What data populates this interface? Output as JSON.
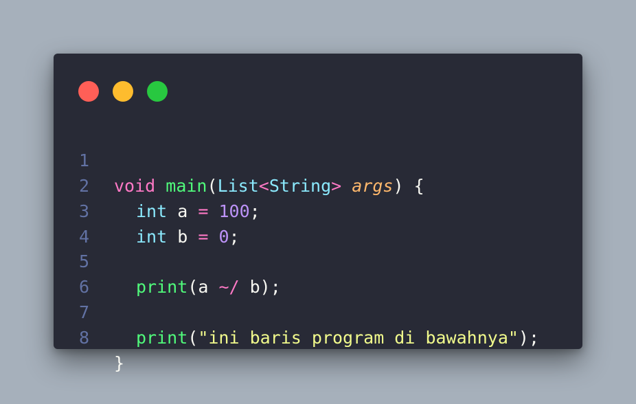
{
  "window": {
    "controls": [
      {
        "name": "close",
        "color": "#ff5f57"
      },
      {
        "name": "minimize",
        "color": "#febc2e"
      },
      {
        "name": "maximize",
        "color": "#28c840"
      }
    ]
  },
  "code": {
    "language": "dart",
    "lines": [
      {
        "number": "1",
        "tokens": [
          "void",
          "main",
          "(",
          "List",
          "<",
          "String",
          ">",
          "args",
          ") {"
        ]
      },
      {
        "number": "2",
        "tokens": [
          "int",
          "a",
          "=",
          "100",
          ";"
        ]
      },
      {
        "number": "3",
        "tokens": [
          "int",
          "b",
          "=",
          "0",
          ";"
        ]
      },
      {
        "number": "4",
        "tokens": []
      },
      {
        "number": "5",
        "tokens": [
          "print",
          "(a",
          "~/",
          "b);"
        ]
      },
      {
        "number": "6",
        "tokens": []
      },
      {
        "number": "7",
        "tokens": [
          "print",
          "(",
          "\"ini baris program di bawahnya\"",
          ");"
        ]
      },
      {
        "number": "8",
        "tokens": [
          "}"
        ]
      }
    ]
  },
  "colors": {
    "background": "#a6b0bb",
    "editor": "#282a36",
    "line_number": "#6272a4",
    "keyword": "#ff79c6",
    "function": "#50fa7b",
    "type": "#8be9fd",
    "param": "#ffb86c",
    "number": "#bd93f9",
    "string": "#f1fa8c",
    "text": "#f8f8f2"
  }
}
